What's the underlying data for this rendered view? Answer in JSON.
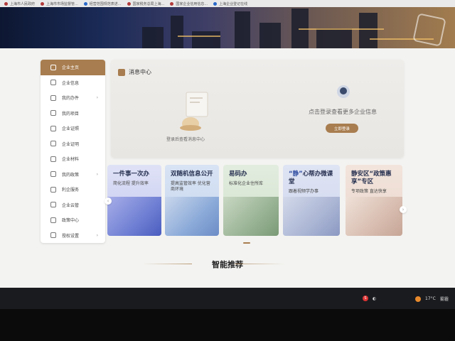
{
  "browser_tabs": [
    {
      "label": "上海市人民政府"
    },
    {
      "label": "上海市市场监督管..."
    },
    {
      "label": "经营范围规范表述..."
    },
    {
      "label": "国家税务总局上海..."
    },
    {
      "label": "国家企业信用信息..."
    },
    {
      "label": "上海企业登记在线"
    }
  ],
  "sidebar": {
    "items": [
      {
        "label": "企业主页",
        "icon": "home-icon",
        "active": true
      },
      {
        "label": "企业信息",
        "icon": "building-icon"
      },
      {
        "label": "我的办件",
        "icon": "document-icon",
        "chevron": "›"
      },
      {
        "label": "我的项目",
        "icon": "project-icon"
      },
      {
        "label": "企业证照",
        "icon": "license-icon"
      },
      {
        "label": "企业证明",
        "icon": "certificate-icon"
      },
      {
        "label": "企业材料",
        "icon": "folder-icon"
      },
      {
        "label": "我的政策",
        "icon": "policy-icon",
        "chevron": "›"
      },
      {
        "label": "利企服务",
        "icon": "service-icon"
      },
      {
        "label": "企业云管",
        "icon": "cloud-icon"
      },
      {
        "label": "政策中心",
        "icon": "center-icon"
      },
      {
        "label": "授权设置",
        "icon": "settings-icon",
        "chevron": "›"
      }
    ]
  },
  "message_center": {
    "title": "消息中心",
    "empty_text": "登录后查看消息中心",
    "login_prompt": "点击登录查看更多企业信息",
    "login_button": "立即登录"
  },
  "cards": [
    {
      "title": "一件事一次办",
      "subtitle": "简化流程 提升效率"
    },
    {
      "title": "双随机信息公开",
      "subtitle": "提高监管效率 优化营商环境"
    },
    {
      "title": "易码办",
      "subtitle": "标准化企业住所库"
    },
    {
      "title_q1": "“静”",
      "title_rest": "心帮办微课堂",
      "subtitle": "跟着视频学办事"
    },
    {
      "title": "静安区“政策惠享”专区",
      "subtitle": "专项政策 直达快享"
    }
  ],
  "section": {
    "title": "智能推荐"
  },
  "taskbar": {
    "tray_s": "S",
    "weather": "17°C",
    "weather_desc": "雾霾"
  }
}
